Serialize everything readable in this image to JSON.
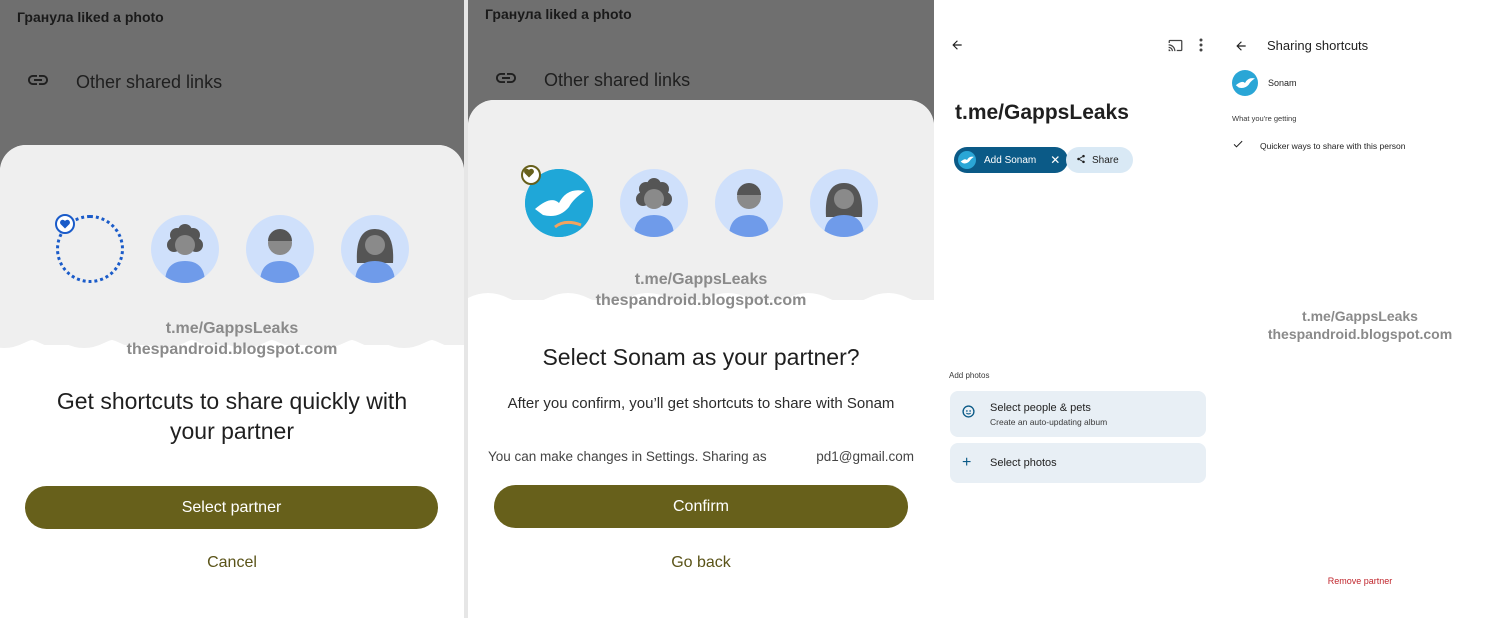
{
  "watermark": {
    "line1": "t.me/GappsLeaks",
    "line2": "thespandroid.blogspot.com"
  },
  "screen1": {
    "notification": "Гранула liked a photo",
    "shared_links_label": "Other shared links",
    "title": "Get shortcuts to share quickly with your partner",
    "primary_button": "Select partner",
    "secondary_button": "Cancel"
  },
  "screen2": {
    "notification": "Гранула liked a photo",
    "shared_links_label": "Other shared links",
    "title": "Select Sonam as your partner?",
    "subtitle": "After you confirm, you’ll get shortcuts to share with Sonam",
    "settings_note": "You can make changes in Settings. Sharing as",
    "account": "pd1@gmail.com",
    "primary_button": "Confirm",
    "secondary_button": "Go back"
  },
  "screen3": {
    "album_title": "t.me/GappsLeaks",
    "chip_add": "Add Sonam",
    "chip_share": "Share",
    "section_label": "Add photos",
    "options": [
      {
        "title": "Select people & pets",
        "subtitle": "Create an auto-updating album",
        "icon": "face-icon"
      },
      {
        "title": "Select photos",
        "subtitle": "",
        "icon": "plus-icon"
      }
    ]
  },
  "screen4": {
    "title": "Sharing shortcuts",
    "person_name": "Sonam",
    "section_label": "What you're getting",
    "benefit": "Quicker ways to share with this person",
    "remove": "Remove partner"
  },
  "colors": {
    "accent_olive": "#67601b",
    "dim_overlay": "#6f6f6f",
    "chip_blue": "#0b5a87",
    "danger_red": "#c0262d"
  }
}
